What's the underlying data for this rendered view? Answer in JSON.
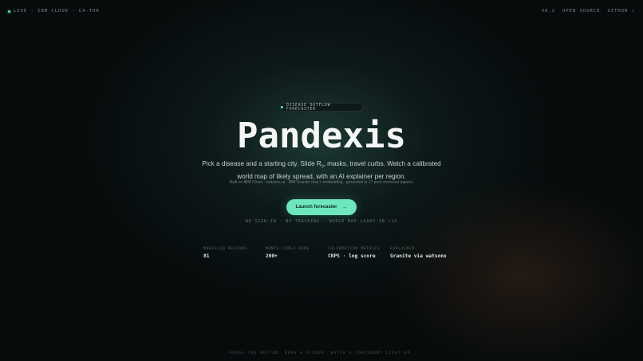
{
  "topbar": {
    "status": "LIVE · IBM CLOUD · CA-TOR",
    "links": [
      "V0.2",
      "OPEN SOURCE",
      "GITHUB ↗"
    ]
  },
  "hero": {
    "badge": "DISEASE OUTFLOW FORECASTER",
    "title": "Pandexis",
    "tagline_before": "Pick a disease and a starting city. Slide R",
    "tagline_sub": "0",
    "tagline_after": ", masks, travel curbs. Watch a calibrated world map of likely spread, with an AI explainer per region.",
    "subline": "Built on IBM Cloud · watsonx.ai · IBM Granite chat + embedding · grounded in 17 peer-reviewed papers.",
    "cta_label": "Launch forecaster",
    "cta_arrow": "→",
    "meta": "NO SIGN-IN · NO TRACKING · WORLD MAP LOADS IN <1S"
  },
  "stats": [
    {
      "label": "MODELLED REGIONS",
      "value": "81"
    },
    {
      "label": "MONTE CARLO RUNS",
      "value": "200+"
    },
    {
      "label": "CALIBRATION METRICS",
      "value": "CRPS · log score"
    },
    {
      "label": "EXPLAINER",
      "value": "Granite via watsonx"
    }
  ],
  "footer": "PRESS THE BUTTON. DRAG A SLIDER. WATCH A CONTINENT LIGHT UP.",
  "colors": {
    "accent": "#6ee7bf",
    "background": "#070b0c"
  }
}
